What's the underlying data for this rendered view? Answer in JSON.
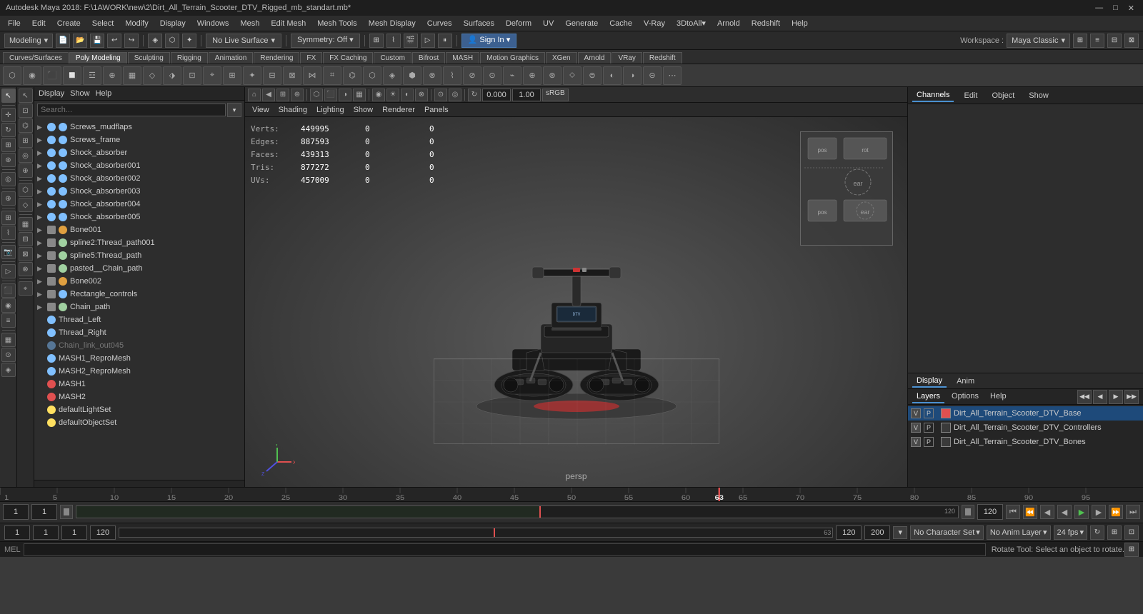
{
  "titlebar": {
    "title": "Autodesk Maya 2018: F:\\1AWORK\\new\\2\\Dirt_All_Terrain_Scooter_DTV_Rigged_mb_standart.mb*",
    "controls": [
      "—",
      "□",
      "✕"
    ]
  },
  "menubar": {
    "items": [
      "File",
      "Edit",
      "Create",
      "Select",
      "Modify",
      "Display",
      "Windows",
      "Mesh",
      "Edit Mesh",
      "Mesh Tools",
      "Mesh Display",
      "Curves",
      "Surfaces",
      "Deform",
      "UV",
      "Generate",
      "Cache",
      "V-Ray",
      "3DtoAll",
      "Arnold",
      "Redshift",
      "Help"
    ]
  },
  "workspacebar": {
    "mode_label": "Modeling",
    "live_surface": "No Live Surface",
    "symmetry": "Symmetry: Off",
    "sign_in": "Sign In",
    "workspace_label": "Workspace :",
    "workspace_value": "Maya Classic"
  },
  "shelftabs": {
    "items": [
      "Curves/Surfaces",
      "Poly Modeling",
      "Sculpting",
      "Rigging",
      "Animation",
      "Rendering",
      "FX",
      "FX Caching",
      "Custom",
      "Bifrost",
      "MASH",
      "Motion Graphics",
      "XGen",
      "Arnold",
      "VRay",
      "Redshift"
    ]
  },
  "outliner": {
    "header": [
      "Display",
      "Show",
      "Help"
    ],
    "search_placeholder": "Search...",
    "items": [
      {
        "name": "Screws_mudflaps",
        "type": "mesh",
        "indent": 2
      },
      {
        "name": "Screws_frame",
        "type": "mesh",
        "indent": 2
      },
      {
        "name": "Shock_absorber",
        "type": "mesh",
        "indent": 2
      },
      {
        "name": "Shock_absorber001",
        "type": "mesh",
        "indent": 2
      },
      {
        "name": "Shock_absorber002",
        "type": "mesh",
        "indent": 2
      },
      {
        "name": "Shock_absorber003",
        "type": "mesh",
        "indent": 2
      },
      {
        "name": "Shock_absorber004",
        "type": "mesh",
        "indent": 2
      },
      {
        "name": "Shock_absorber005",
        "type": "mesh",
        "indent": 2
      },
      {
        "name": "Bone001",
        "type": "joint",
        "indent": 2
      },
      {
        "name": "spline2:Thread_path001",
        "type": "curve",
        "indent": 2
      },
      {
        "name": "spline5:Thread_path",
        "type": "curve",
        "indent": 2
      },
      {
        "name": "pasted__Chain_path",
        "type": "curve",
        "indent": 2
      },
      {
        "name": "Bone002",
        "type": "joint",
        "indent": 2
      },
      {
        "name": "Rectangle_controls",
        "type": "group",
        "indent": 2
      },
      {
        "name": "Chain_path",
        "type": "curve",
        "indent": 2
      },
      {
        "name": "Thread_Left",
        "type": "mesh",
        "indent": 2
      },
      {
        "name": "Thread_Right",
        "type": "mesh",
        "indent": 2
      },
      {
        "name": "Chain_link_out045",
        "type": "mesh",
        "indent": 2,
        "grayed": true
      },
      {
        "name": "MASH1_ReproMesh",
        "type": "mesh",
        "indent": 2
      },
      {
        "name": "MASH2_ReproMesh",
        "type": "mesh",
        "indent": 2
      },
      {
        "name": "MASH1",
        "type": "red",
        "indent": 2
      },
      {
        "name": "MASH2",
        "type": "red",
        "indent": 2
      },
      {
        "name": "defaultLightSet",
        "type": "light",
        "indent": 2
      },
      {
        "name": "defaultObjectSet",
        "type": "light",
        "indent": 2
      }
    ]
  },
  "viewport": {
    "menus": [
      "View",
      "Shading",
      "Lighting",
      "Show",
      "Renderer",
      "Panels"
    ],
    "stats": {
      "verts_label": "Verts:",
      "verts_val": "449995",
      "verts_extra1": "0",
      "verts_extra2": "0",
      "edges_label": "Edges:",
      "edges_val": "887593",
      "edges_extra1": "0",
      "edges_extra2": "0",
      "faces_label": "Faces:",
      "faces_val": "439313",
      "faces_extra1": "0",
      "faces_extra2": "0",
      "tris_label": "Tris:",
      "tris_val": "877272",
      "tris_extra1": "0",
      "tris_extra2": "0",
      "uvs_label": "UVs:",
      "uvs_val": "457009",
      "uvs_extra1": "0",
      "uvs_extra2": "0"
    },
    "camera_label": "persp",
    "camera_val_label": "0.000",
    "camera_val2": "1.00",
    "color_space": "sRGB"
  },
  "right_panel": {
    "tabs": [
      "Channels",
      "Edit",
      "Object",
      "Show"
    ],
    "bottom_tabs": [
      "Display",
      "Anim"
    ],
    "layers_tabs": [
      "Layers",
      "Options",
      "Help"
    ],
    "layers": [
      {
        "name": "Dirt_All_Terrain_Scooter_DTV_Base",
        "v": true,
        "p": true,
        "selected": true,
        "color": "#e05050"
      },
      {
        "name": "Dirt_All_Terrain_Scooter_DTV_Controllers",
        "v": true,
        "p": true,
        "selected": false,
        "color": "#4a4a4a"
      },
      {
        "name": "Dirt_All_Terrain_Scooter_DTV_Bones",
        "v": true,
        "p": true,
        "selected": false,
        "color": "#4a4a4a"
      }
    ]
  },
  "timeline": {
    "start": "1",
    "current": "63",
    "end": "120",
    "range_start": "1",
    "range_end": "120",
    "out": "200",
    "fps": "24 fps"
  },
  "playback_controls": {
    "prev_key": "⏮",
    "prev_frame": "◀◀",
    "play_rev": "◀",
    "prev": "◀",
    "play": "▶",
    "next": "▶",
    "next_frame": "▶▶",
    "next_key": "⏭"
  },
  "bottom_controls": {
    "frame_start": "1",
    "frame_end": "1",
    "playback_start": "1",
    "anim_end": "120",
    "range_end": "120",
    "out_time": "200",
    "no_character_set": "No Character Set",
    "no_anim_layer": "No Anim Layer",
    "fps": "24 fps"
  },
  "statusbar": {
    "text": "Rotate Tool: Select an object to rotate.",
    "lang": "MEL"
  }
}
